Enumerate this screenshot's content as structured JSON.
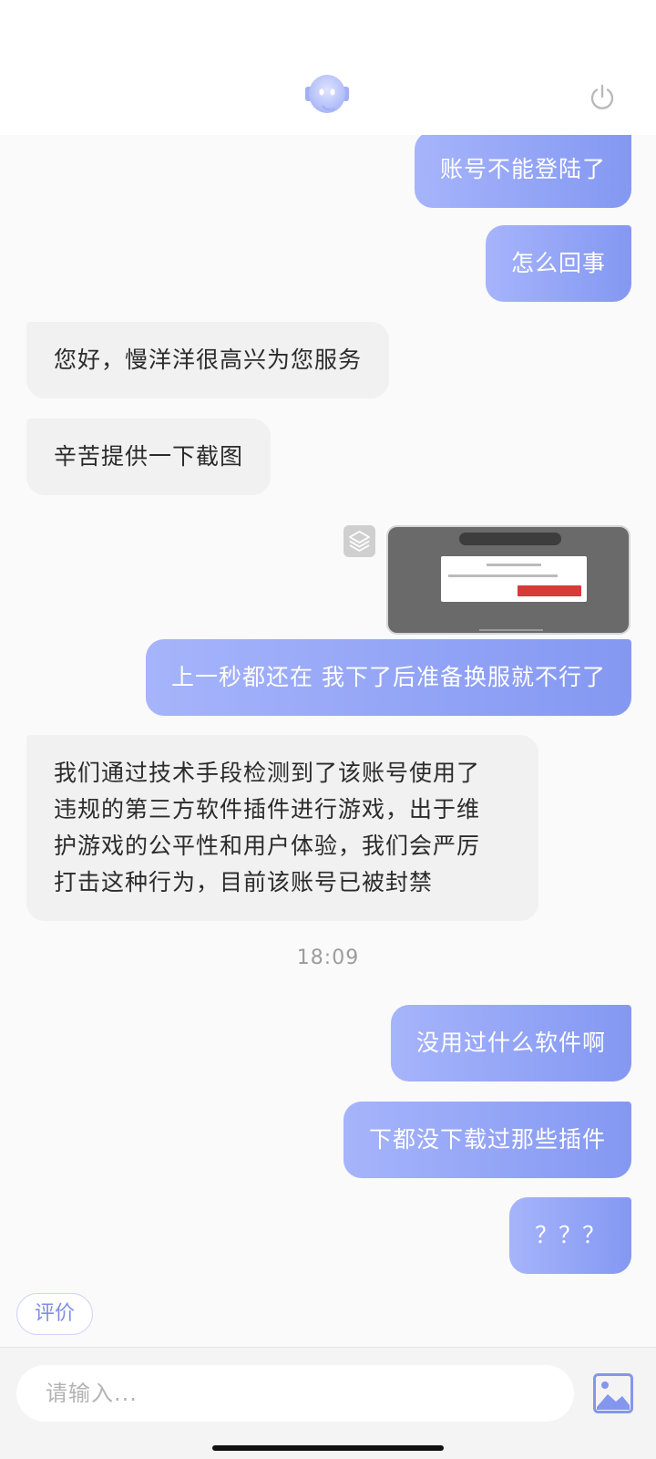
{
  "header": {
    "avatar_icon": "robot-assistant-icon",
    "power_icon": "power-icon"
  },
  "messages": [
    {
      "side": "out",
      "text": "账号不能登陆了"
    },
    {
      "side": "out",
      "text": "怎么回事"
    },
    {
      "side": "in",
      "text": "您好，慢洋洋很高兴为您服务"
    },
    {
      "side": "in",
      "text": "辛苦提供一下截图"
    },
    {
      "side": "out",
      "type": "image",
      "icon": "layers-icon"
    },
    {
      "side": "out",
      "text": "上一秒都还在 我下了后准备换服就不行了"
    },
    {
      "side": "in",
      "lines": [
        "我们通过技术手段检测到了该账号使用了",
        "违规的第三方软件插件进行游戏，出于维",
        "护游戏的公平性和用户体验，我们会严厉",
        "打击这种行为，目前该账号已被封禁"
      ]
    },
    {
      "side": "out",
      "text": "没用过什么软件啊"
    },
    {
      "side": "out",
      "text": "下都没下载过那些插件"
    },
    {
      "side": "out",
      "text": "？？？"
    }
  ],
  "timestamp": "18:09",
  "rate_button": "评价",
  "input": {
    "placeholder": "请输入..."
  },
  "image_button_icon": "image-icon",
  "colors": {
    "outgoing_bubble_start": "#a6b4fb",
    "outgoing_bubble_end": "#8498f2",
    "incoming_bubble": "#f1f1f1",
    "accent": "#7d8fe8"
  }
}
